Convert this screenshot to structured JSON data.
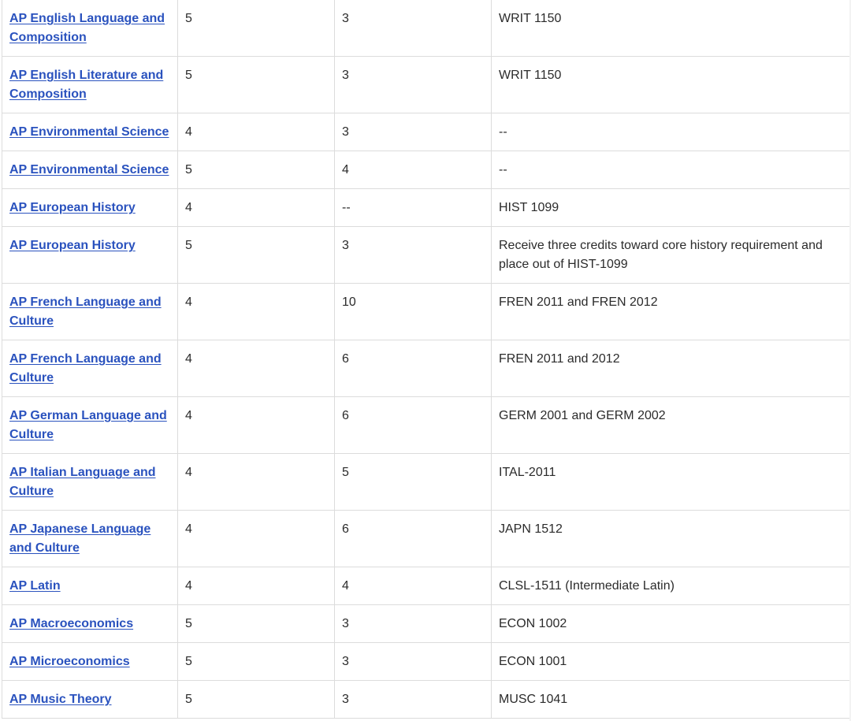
{
  "rows": [
    {
      "exam": "AP English Language and Composition",
      "score": "5",
      "credits": "3",
      "equivalent": "WRIT 1150",
      "tall": true
    },
    {
      "exam": "AP English Literature and Composition",
      "score": "5",
      "credits": "3",
      "equivalent": "WRIT 1150",
      "tall": true
    },
    {
      "exam": "AP Environmental Science",
      "score": "4",
      "credits": "3",
      "equivalent": "--",
      "tall": false
    },
    {
      "exam": "AP Environmental Science",
      "score": "5",
      "credits": "4",
      "equivalent": "--",
      "tall": false
    },
    {
      "exam": "AP European History",
      "score": "4",
      "credits": "--",
      "equivalent": "HIST 1099",
      "tall": false
    },
    {
      "exam": "AP European History",
      "score": "5",
      "credits": "3",
      "equivalent": "Receive three credits toward core history requirement and place out of HIST-1099",
      "tall": true
    },
    {
      "exam": "AP French Language and Culture",
      "score": "4",
      "credits": "10",
      "equivalent": "FREN 2011 and FREN 2012",
      "tall": true
    },
    {
      "exam": "AP French Language and Culture",
      "score": "4",
      "credits": "6",
      "equivalent": "FREN 2011 and 2012",
      "tall": true
    },
    {
      "exam": "AP German Language and Culture",
      "score": "4",
      "credits": "6",
      "equivalent": "GERM 2001 and GERM 2002",
      "tall": true
    },
    {
      "exam": "AP Italian Language and Culture",
      "score": "4",
      "credits": "5",
      "equivalent": "ITAL-2011",
      "tall": true
    },
    {
      "exam": "AP Japanese Language and Culture",
      "score": "4",
      "credits": "6",
      "equivalent": "JAPN 1512",
      "tall": true
    },
    {
      "exam": "AP Latin",
      "score": "4",
      "credits": "4",
      "equivalent": "CLSL-1511 (Intermediate Latin)",
      "tall": false
    },
    {
      "exam": "AP Macroeconomics",
      "score": "5",
      "credits": "3",
      "equivalent": "ECON 1002",
      "tall": false
    },
    {
      "exam": "AP Microeconomics",
      "score": "5",
      "credits": "3",
      "equivalent": "ECON 1001",
      "tall": false
    },
    {
      "exam": "AP Music Theory",
      "score": "5",
      "credits": "3",
      "equivalent": "MUSC 1041",
      "tall": false
    }
  ]
}
